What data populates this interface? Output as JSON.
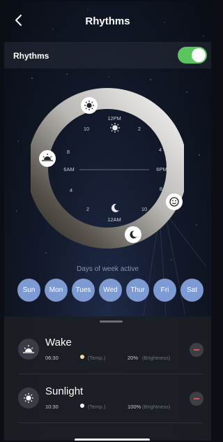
{
  "header": {
    "title": "Rhythms",
    "back_icon": "chevron-left-icon"
  },
  "toggle": {
    "label": "Rhythms",
    "on": true,
    "color": "#5cc35e"
  },
  "clock": {
    "labels": {
      "noon": "12PM",
      "midnight": "12AM",
      "six_am": "6AM",
      "six_pm": "6PM",
      "h10a": "10",
      "h2a": "2",
      "h8a": "8",
      "h4a": "4",
      "h4b": "4",
      "h8b": "8",
      "h2b": "2",
      "h10b": "10"
    },
    "markers": [
      "sun-icon",
      "sunrise-icon",
      "smile-icon",
      "moon-icon"
    ]
  },
  "days_label": "Days of week active",
  "days": [
    "Sun",
    "Mon",
    "Tues",
    "Wed",
    "Thur",
    "Fri",
    "Sat"
  ],
  "day_color": "#7e9ad2",
  "items": [
    {
      "name": "Wake",
      "time": "06:30",
      "temp_label": "(Temp.)",
      "brightness": "20%",
      "brightness_label": "(Brightness)",
      "icon": "sunrise-icon",
      "temp_color": "#f3d9a4"
    },
    {
      "name": "Sunlight",
      "time": "10:30",
      "temp_label": "(Temp.)",
      "brightness": "100%",
      "brightness_label": "(Brightness)",
      "icon": "sun-icon",
      "temp_color": "#ffffff"
    }
  ]
}
